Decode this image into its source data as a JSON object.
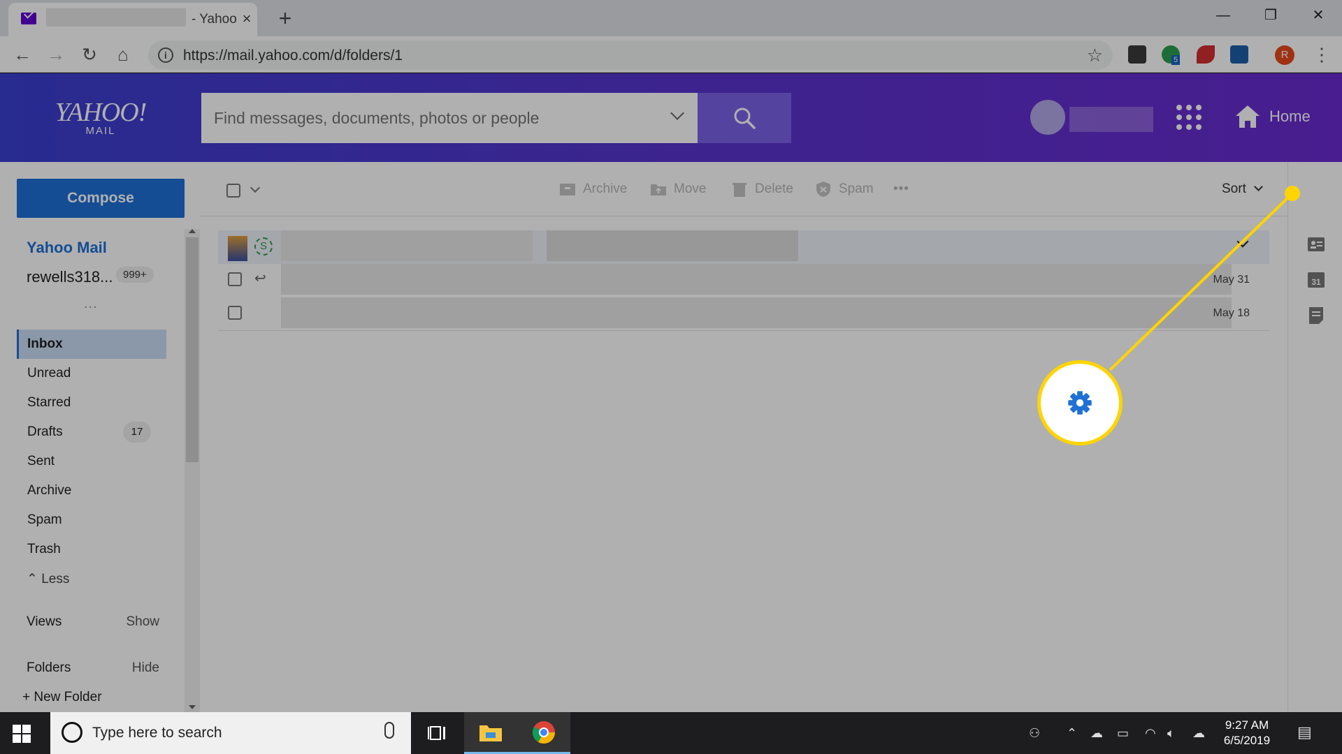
{
  "browser": {
    "tab_title": "- Yahoo",
    "tab_close": "×",
    "new_tab": "+",
    "url": "https://mail.yahoo.com/d/folders/1",
    "controls": {
      "minimize": "—",
      "restore": "❐",
      "close": "✕"
    },
    "profile_initial": "R",
    "extension_badge": "5"
  },
  "header": {
    "logo_line1": "YAHOO!",
    "logo_line2": "MAIL",
    "search_placeholder": "Find messages, documents, photos or people",
    "home_label": "Home"
  },
  "sidebar": {
    "compose_label": "Compose",
    "account_title": "Yahoo Mail",
    "account_email": "rewells318...",
    "account_badge": "999+",
    "ellipsis": "...",
    "folders": [
      {
        "label": "Inbox",
        "active": true
      },
      {
        "label": "Unread"
      },
      {
        "label": "Starred"
      },
      {
        "label": "Drafts",
        "count": "17"
      },
      {
        "label": "Sent"
      },
      {
        "label": "Archive"
      },
      {
        "label": "Spam"
      },
      {
        "label": "Trash"
      }
    ],
    "less_label": "Less",
    "views_label": "Views",
    "views_action": "Show",
    "folders_label": "Folders",
    "folders_action": "Hide",
    "new_folder_label": "+ New Folder"
  },
  "toolbar": {
    "archive": "Archive",
    "move": "Move",
    "delete": "Delete",
    "spam": "Spam",
    "more": "•••",
    "sort": "Sort"
  },
  "messages": [
    {
      "date": ""
    },
    {
      "date": "May 31"
    },
    {
      "date": "May 18"
    }
  ],
  "taskbar": {
    "search_placeholder": "Type here to search",
    "time": "9:27 AM",
    "date": "6/5/2019"
  },
  "colors": {
    "header_gradient_start": "#3a3fd0",
    "header_gradient_end": "#6a2bd0",
    "compose_blue": "#1e70d6",
    "highlight_yellow": "#ffd400",
    "gear_blue": "#1e70d6"
  },
  "icons": {
    "settings": "gear-icon",
    "search": "search-icon",
    "home": "home-icon",
    "apps": "apps-grid-icon",
    "contacts": "contacts-icon",
    "calendar": "calendar-icon",
    "notepad": "notepad-icon"
  }
}
